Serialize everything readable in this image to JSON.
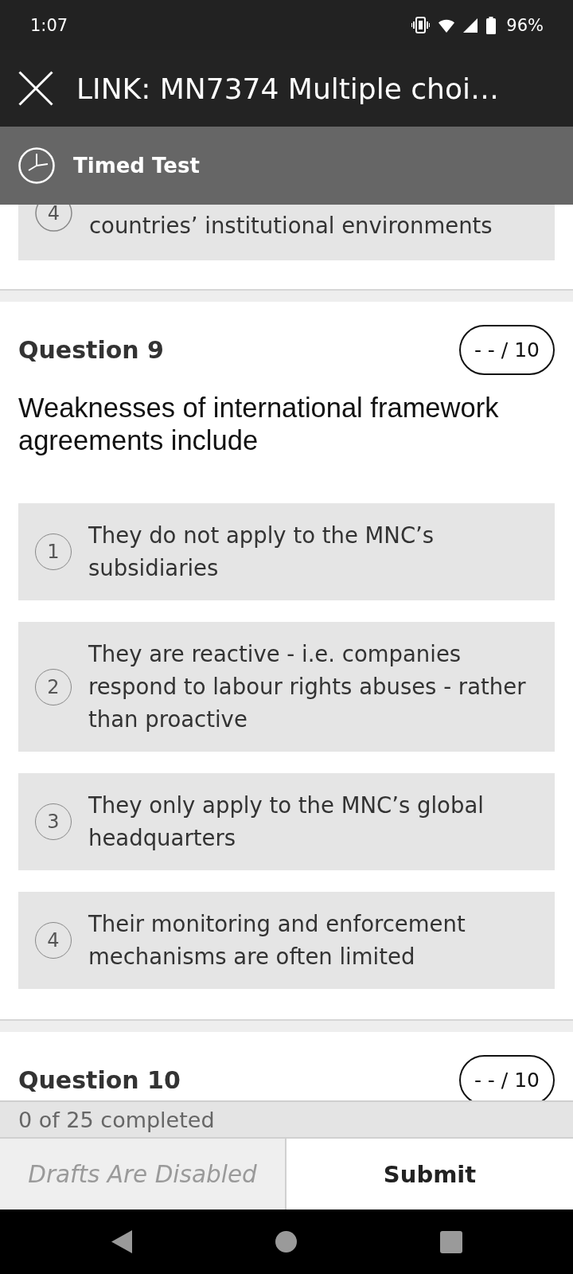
{
  "status_bar": {
    "time": "1:07",
    "battery": "96%"
  },
  "header": {
    "title": "LINK: MN7374 Multiple choi…",
    "banner": "Timed Test"
  },
  "previous_option": {
    "number": "4",
    "text": "countries’ institutional environments",
    "selected": false
  },
  "questions": [
    {
      "title": "Question 9",
      "score": "- - / 10",
      "prompt": "Weaknesses of international framework agreements include",
      "options": [
        {
          "number": "1",
          "text": "They do not apply to the MNC’s subsidiaries",
          "selected": false
        },
        {
          "number": "2",
          "text": "They are reactive - i.e. companies respond to labour rights abuses - rather than proactive",
          "selected": false
        },
        {
          "number": "3",
          "text": "They only apply to the MNC’s global headquarters",
          "selected": false
        },
        {
          "number": "4",
          "text": "Their monitoring and enforcement mechanisms are often limited",
          "selected": false
        }
      ]
    },
    {
      "title": "Question 10",
      "score": "- - / 10"
    }
  ],
  "progress": "0 of 25 completed",
  "footer": {
    "drafts": {
      "label": "Drafts Are Disabled",
      "disabled": true
    },
    "submit": "Submit"
  }
}
